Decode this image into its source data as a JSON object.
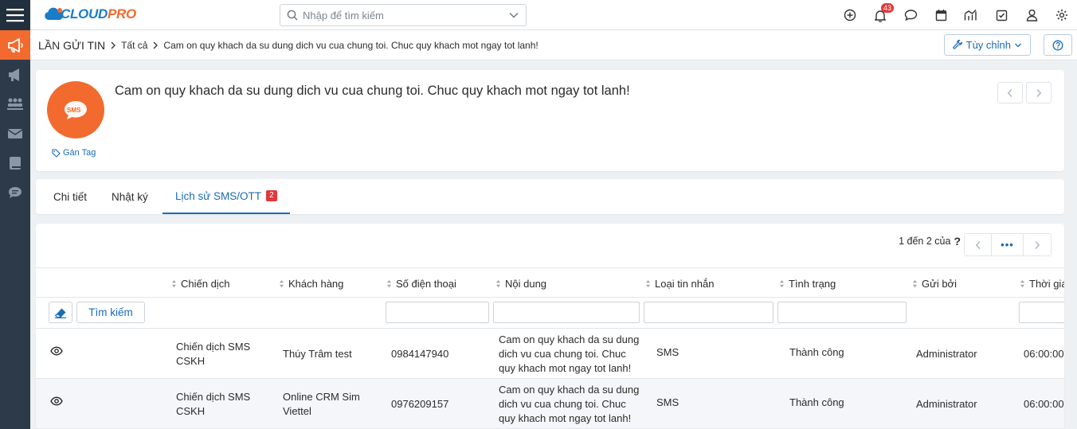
{
  "app": {
    "logo_main": "CLOUD",
    "logo_accent": "PRO",
    "accent_color": "#f26a2e",
    "primary_color": "#1a6cb3"
  },
  "search": {
    "placeholder": "Nhập để tìm kiếm"
  },
  "notifications": {
    "count": "43"
  },
  "sidebar": {
    "items": [
      {
        "icon": "megaphone-icon",
        "active": true
      },
      {
        "icon": "bullhorn-icon",
        "active": false
      },
      {
        "icon": "group-icon",
        "active": false
      },
      {
        "icon": "envelope-icon",
        "active": false
      },
      {
        "icon": "book-icon",
        "active": false
      },
      {
        "icon": "chat-bubble-icon",
        "active": false
      }
    ]
  },
  "breadcrumb": {
    "module": "LẦN GỬI TIN",
    "all": "Tất cả",
    "current": "Cam on quy khach da su dung dich vu cua chung toi. Chuc quy khach mot ngay tot lanh!"
  },
  "header_buttons": {
    "customize": "Tùy chỉnh"
  },
  "record": {
    "avatar_text": "SMS",
    "tag_label": "Gán Tag",
    "title": "Cam on quy khach da su dung dich vu cua chung toi. Chuc quy khach mot ngay tot lanh!"
  },
  "tabs": [
    {
      "label": "Chi tiết"
    },
    {
      "label": "Nhật ký"
    },
    {
      "label": "Lịch sử SMS/OTT",
      "badge": "2"
    }
  ],
  "paging": {
    "text": "1 đến 2 của",
    "help": "?",
    "more": "•••"
  },
  "table": {
    "columns": [
      "Chiến dịch",
      "Khách hàng",
      "Số điện thoại",
      "Nội dung",
      "Loại tin nhắn",
      "Tình trạng",
      "Gửi bởi",
      "Thời gian"
    ],
    "search_button": "Tìm kiếm",
    "rows": [
      {
        "campaign": "Chiến dịch SMS CSKH",
        "customer": "Thúy Trâm test",
        "phone": "0984147940",
        "content": "Cam on quy khach da su dung dich vu cua chung toi. Chuc quy khach mot ngay tot lanh!",
        "type": "SMS",
        "status": "Thành công",
        "sender": "Administrator",
        "time": "06:00:00"
      },
      {
        "campaign": "Chiến dịch SMS CSKH",
        "customer": "Online CRM Sim Viettel",
        "phone": "0976209157",
        "content": "Cam on quy khach da su dung dich vu cua chung toi. Chuc quy khach mot ngay tot lanh!",
        "type": "SMS",
        "status": "Thành công",
        "sender": "Administrator",
        "time": "06:00:00"
      }
    ]
  }
}
